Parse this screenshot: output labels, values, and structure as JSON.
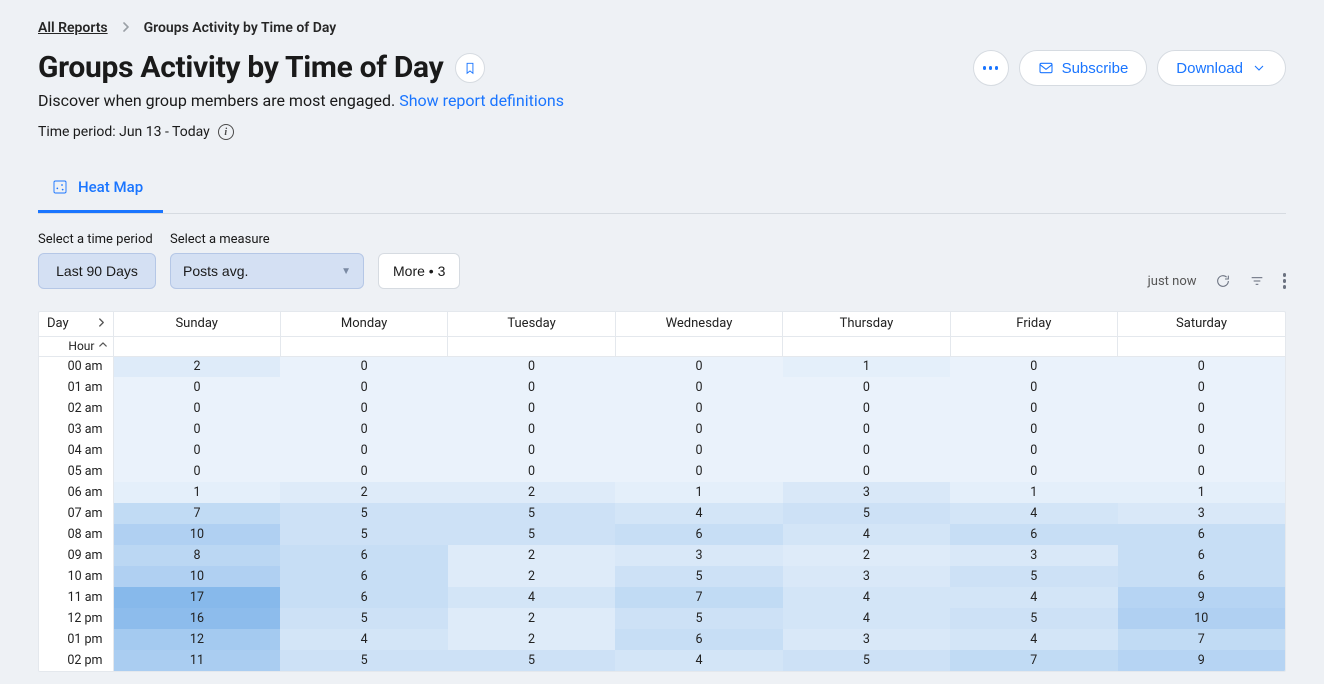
{
  "breadcrumb": {
    "root": "All Reports",
    "current": "Groups Activity by Time of Day"
  },
  "title": "Groups Activity by Time of Day",
  "subtitle_text": "Discover when group members are most engaged. ",
  "subtitle_link": "Show report definitions",
  "time_period_label": "Time period: Jun 13 - Today",
  "actions": {
    "subscribe": "Subscribe",
    "download": "Download"
  },
  "tabs": {
    "heatmap": "Heat Map"
  },
  "controls": {
    "period_label": "Select a time period",
    "period_value": "Last 90 Days",
    "measure_label": "Select a measure",
    "measure_value": "Posts avg.",
    "more_label": "More • 3",
    "timestamp": "just now"
  },
  "table": {
    "day_header": "Day",
    "hour_header": "Hour"
  },
  "chart_data": {
    "type": "heatmap",
    "title": "Groups Activity by Time of Day — Posts avg.",
    "xlabel": "Day",
    "ylabel": "Hour",
    "categories": [
      "Sunday",
      "Monday",
      "Tuesday",
      "Wednesday",
      "Thursday",
      "Friday",
      "Saturday"
    ],
    "hours": [
      "00 am",
      "01 am",
      "02 am",
      "03 am",
      "04 am",
      "05 am",
      "06 am",
      "07 am",
      "08 am",
      "09 am",
      "10 am",
      "11 am",
      "12 pm",
      "01 pm",
      "02 pm"
    ],
    "values": [
      [
        2,
        0,
        0,
        0,
        1,
        0,
        0
      ],
      [
        0,
        0,
        0,
        0,
        0,
        0,
        0
      ],
      [
        0,
        0,
        0,
        0,
        0,
        0,
        0
      ],
      [
        0,
        0,
        0,
        0,
        0,
        0,
        0
      ],
      [
        0,
        0,
        0,
        0,
        0,
        0,
        0
      ],
      [
        0,
        0,
        0,
        0,
        0,
        0,
        0
      ],
      [
        1,
        2,
        2,
        1,
        3,
        1,
        1
      ],
      [
        7,
        5,
        5,
        4,
        5,
        4,
        3
      ],
      [
        10,
        5,
        5,
        6,
        4,
        6,
        6
      ],
      [
        8,
        6,
        2,
        3,
        2,
        3,
        6
      ],
      [
        10,
        6,
        2,
        5,
        3,
        5,
        6
      ],
      [
        17,
        6,
        4,
        7,
        4,
        4,
        9
      ],
      [
        16,
        5,
        2,
        5,
        4,
        5,
        10
      ],
      [
        12,
        4,
        2,
        6,
        3,
        4,
        7
      ],
      [
        11,
        5,
        5,
        4,
        5,
        7,
        9
      ]
    ],
    "range": [
      0,
      17
    ]
  }
}
